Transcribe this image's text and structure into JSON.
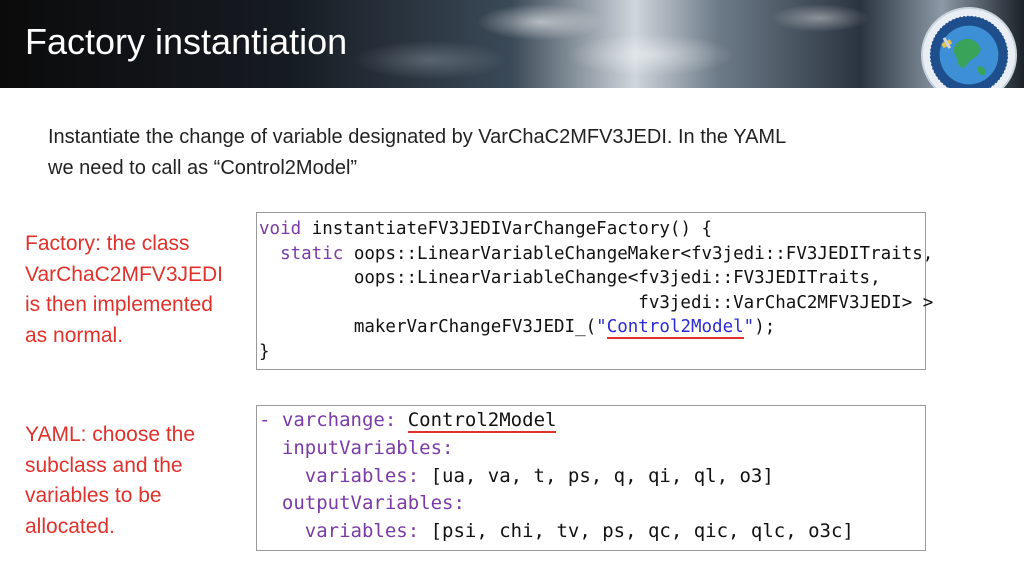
{
  "slide": {
    "title": "Factory instantiation",
    "intro_line1": "Instantiate the change of variable designated by VarChaC2MFV3JEDI. In the YAML",
    "intro_line2": "we need to call as “Control2Model”",
    "logo_name": "joint-center-satellite-data-assimilation-logo"
  },
  "notes": {
    "factory": [
      "Factory: the class",
      "VarChaC2MFV3JEDI",
      "is then implemented",
      "as normal."
    ],
    "yaml": [
      "YAML: choose the",
      "subclass and the",
      "variables to be",
      "allocated."
    ]
  },
  "code": {
    "l1_kw": "void",
    "l1_rest": " instantiateFV3JEDIVarChangeFactory() {",
    "l2_indent": "  ",
    "l2_kw": "static",
    "l2_rest": " oops::LinearVariableChangeMaker<fv3jedi::FV3JEDITraits,",
    "l3": "         oops::LinearVariableChange<fv3jedi::FV3JEDITraits,",
    "l4": "                                    fv3jedi::VarChaC2MFV3JEDI> >",
    "l5_pre": "         makerVarChangeFV3JEDI_(",
    "l5_q1": "\"",
    "l5_str": "Control2Model",
    "l5_q2": "\"",
    "l5_post": ");",
    "l6": "}"
  },
  "yaml": {
    "dash": "- ",
    "varchange_key": "varchange:",
    "varchange_val": "Control2Model",
    "input_key": "inputVariables:",
    "vars_key": "variables:",
    "input_vars": "[ua, va, t, ps, q, qi, ql, o3]",
    "output_key": "outputVariables:",
    "output_vars": "[psi, chi, tv, ps, qc, qic, qlc, o3c]"
  },
  "colors": {
    "note_red": "#e0312b",
    "keyword_purple": "#7a3aa8",
    "string_blue": "#2b2bd1"
  }
}
